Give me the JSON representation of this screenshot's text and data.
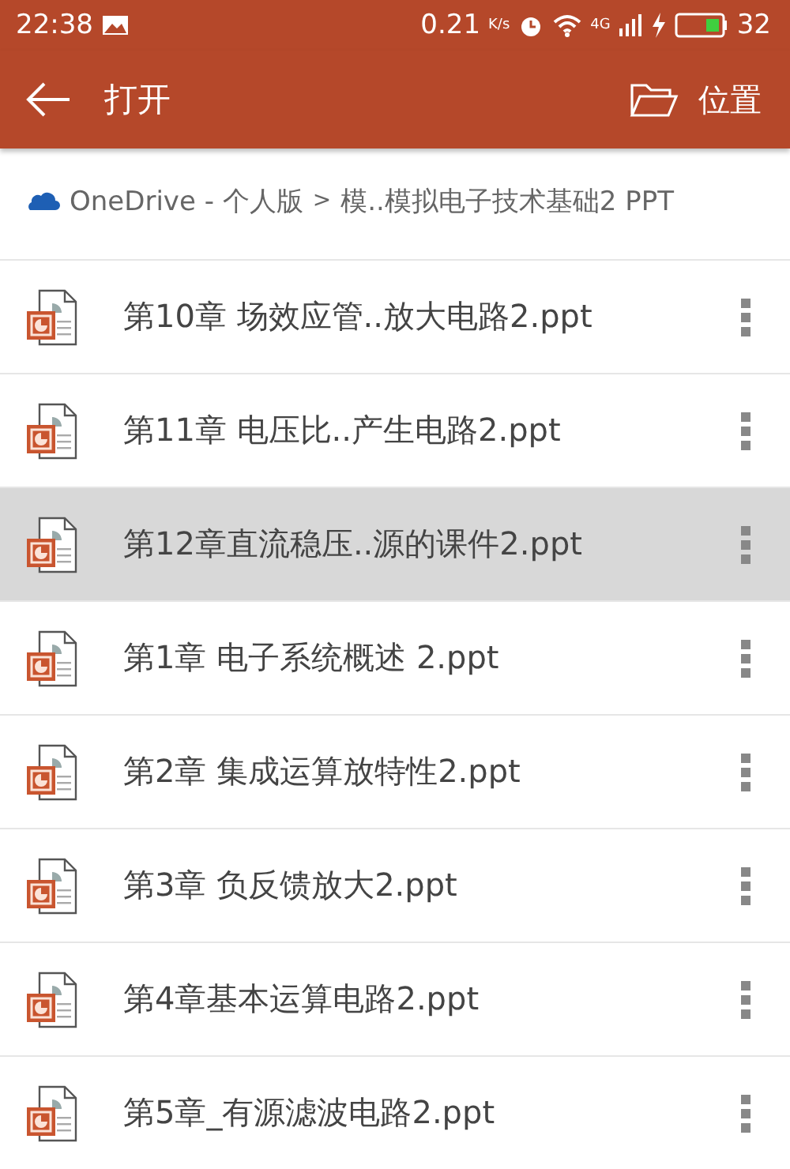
{
  "status_bar": {
    "time": "22:38",
    "speed": "0.21",
    "speed_unit": "K/s",
    "network": "4G",
    "battery": "32"
  },
  "app_bar": {
    "title": "打开",
    "action": "位置"
  },
  "breadcrumb": {
    "root": "OneDrive - 个人版",
    "separator": ">",
    "path": "模..模拟电子技术基础2 PPT"
  },
  "files": [
    {
      "name": "第10章 场效应管..放大电路2.ppt",
      "selected": false
    },
    {
      "name": "第11章  电压比..产生电路2.ppt",
      "selected": false
    },
    {
      "name": "第12章直流稳压..源的课件2.ppt",
      "selected": true
    },
    {
      "name": "第1章  电子系统概述 2.ppt",
      "selected": false
    },
    {
      "name": "第2章 集成运算放特性2.ppt",
      "selected": false
    },
    {
      "name": "第3章 负反馈放大2.ppt",
      "selected": false
    },
    {
      "name": "第4章基本运算电路2.ppt",
      "selected": false
    },
    {
      "name": "第5章_有源滤波电路2.ppt",
      "selected": false
    }
  ]
}
